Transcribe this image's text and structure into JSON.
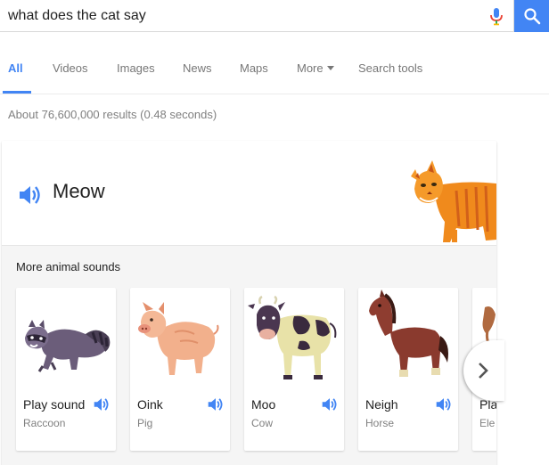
{
  "search": {
    "query": "what does the cat say",
    "mic_icon": "microphone-icon",
    "search_icon": "magnifier-icon"
  },
  "tabs": [
    {
      "label": "All",
      "active": true
    },
    {
      "label": "Videos",
      "active": false
    },
    {
      "label": "Images",
      "active": false
    },
    {
      "label": "News",
      "active": false
    },
    {
      "label": "Maps",
      "active": false
    },
    {
      "label": "More",
      "active": false
    },
    {
      "label": "Search tools",
      "active": false
    }
  ],
  "result_stats": "About 76,600,000 results (0.48 seconds)",
  "answer_card": {
    "sound": "Meow",
    "speaker_icon": "speaker-icon",
    "animal_image": "cat-illustration"
  },
  "more_sounds": {
    "title": "More animal sounds",
    "items": [
      {
        "sound": "Play sound",
        "animal": "Raccoon",
        "image": "raccoon-illustration"
      },
      {
        "sound": "Oink",
        "animal": "Pig",
        "image": "pig-illustration"
      },
      {
        "sound": "Moo",
        "animal": "Cow",
        "image": "cow-illustration"
      },
      {
        "sound": "Neigh",
        "animal": "Horse",
        "image": "horse-illustration"
      },
      {
        "sound": "Pla",
        "animal": "Ele",
        "image": "elephant-illustration"
      }
    ],
    "next_icon": "chevron-right-icon"
  },
  "colors": {
    "accent": "#4285f4",
    "muted_text": "#777777",
    "stats_text": "#808080",
    "panel_bg": "#f5f5f5",
    "mic_red": "#ea4335"
  }
}
